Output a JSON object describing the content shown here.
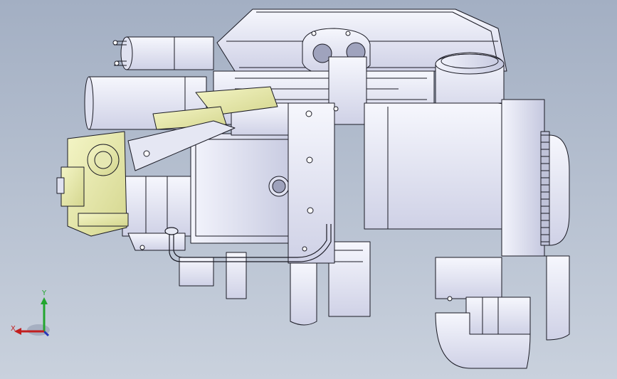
{
  "viewport": {
    "background_top": "#a3afc3",
    "background_bottom": "#c9d1dd"
  },
  "model": {
    "body_fill": "#eeeff9",
    "body_shade": "#cfd1e6",
    "edge_color": "#1a1a24",
    "highlight_fill": "#eef0b4",
    "highlight_shade": "#d9db92"
  },
  "triad": {
    "x_label": "X",
    "y_label": "Y",
    "x_color": "#c21f1f",
    "y_color": "#23a62f",
    "z_color": "#2636b8"
  }
}
